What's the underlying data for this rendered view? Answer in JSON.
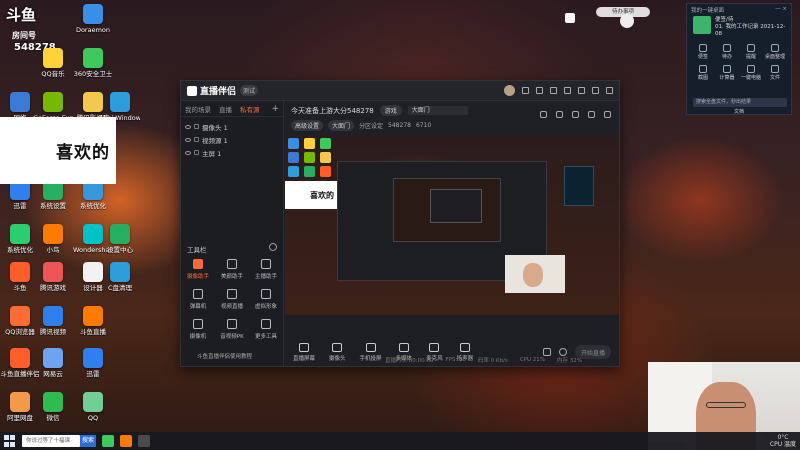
{
  "room_badge": {
    "logo": "斗鱼",
    "title": "房间号",
    "number": "548278"
  },
  "desktop_icons": [
    {
      "label": "Doraemon",
      "color": "#3a8ee6"
    },
    {
      "label": "QQ音乐",
      "color": "#ffd23a"
    },
    {
      "label": "360安全卫士",
      "color": "#3ec95c"
    },
    {
      "label": "网络",
      "color": "#3a7bd5"
    },
    {
      "label": "GeForce Experience",
      "color": "#76b900"
    },
    {
      "label": "腾讯影视库",
      "color": "#f2c94c"
    },
    {
      "label": "Mini Window",
      "color": "#2d9cdb"
    },
    {
      "label": "迅雷",
      "color": "#2f80ed"
    },
    {
      "label": "系统设置",
      "color": "#27ae60"
    },
    {
      "label": "系统优化",
      "color": "#3498db"
    },
    {
      "label": "系统优化",
      "color": "#2ecc71"
    },
    {
      "label": "小鸟",
      "color": "#ff7b00"
    },
    {
      "label": "Wondershare Filmora",
      "color": "#00c2c7"
    },
    {
      "label": "设置中心",
      "color": "#27ae60"
    },
    {
      "label": "斗鱼",
      "color": "#ff5d2a"
    },
    {
      "label": "腾讯游戏",
      "color": "#eb5757"
    },
    {
      "label": "设计器",
      "color": "#f2f2f2"
    },
    {
      "label": "C盘清理",
      "color": "#2d9cdb"
    },
    {
      "label": "QQ浏览器",
      "color": "#ff6b35"
    },
    {
      "label": "腾讯视频",
      "color": "#2f80ed"
    },
    {
      "label": "斗鱼直播",
      "color": "#ff7a00"
    },
    {
      "label": "斗鱼直播伴侣",
      "color": "#ff5d2a"
    },
    {
      "label": "网易云",
      "color": "#6fa3ef"
    },
    {
      "label": "迅雷",
      "color": "#2f80ed"
    },
    {
      "label": "阿里网盘",
      "color": "#f2994a"
    },
    {
      "label": "微信",
      "color": "#2fbb4f"
    },
    {
      "label": "QQ",
      "color": "#6fcf97"
    }
  ],
  "sticker_text": "喜欢的",
  "app": {
    "title": "直播伴侣",
    "beta": "测试",
    "tabs": [
      "我的场景",
      "直播",
      "私有源"
    ],
    "active_tab": "私有源",
    "scenes": [
      "摄像头 1",
      "视频源 1",
      "主屏 1"
    ],
    "tools_title": "工具栏",
    "tools": [
      {
        "label": "摄像助手",
        "hot": true
      },
      {
        "label": "美颜助手",
        "hot": false
      },
      {
        "label": "主播助手",
        "hot": false
      },
      {
        "label": "弹幕机",
        "hot": false
      },
      {
        "label": "视频直播",
        "hot": false
      },
      {
        "label": "虚拟形象",
        "hot": false
      },
      {
        "label": "摄像机",
        "hot": false
      },
      {
        "label": "音视频PK",
        "hot": false
      },
      {
        "label": "更多工具",
        "hot": false
      }
    ],
    "tools_footer": "斗鱼直播伴侣使用教程",
    "stream_title": "今天准备上游大分548278",
    "category_pill": "游戏",
    "category_input": "大面门",
    "row2": [
      "高级设置",
      "大面门",
      "分区设定"
    ],
    "room_id": "548278",
    "viewers": "6710",
    "controls": [
      "直播屏幕",
      "摄像头",
      "手机投屏",
      "多媒体",
      "麦克风",
      "扬声器"
    ],
    "start_label": "开始直播",
    "status": [
      "直播时长 00:00:00",
      "FPS: 30",
      "码率 0 Kb/s",
      "CPU 21%",
      "内存 32%"
    ]
  },
  "widget": {
    "header_left": "我的一键桌面",
    "header_right": "— ×",
    "title": "便签/待",
    "sub": "01. 我的工作记录 2021-12-08",
    "grid": [
      "便签",
      "待办",
      "提醒",
      "桌面整理",
      "截图",
      "计算器",
      "一键电脑",
      "文件"
    ],
    "search": "搜索全盘文件，秒出结果",
    "footer": "文档"
  },
  "top_pill": "待办事项",
  "taskbar": {
    "search_placeholder": "你说过等了十福课",
    "search_btn": "搜索",
    "temp": "0°C",
    "cpu": "CPU 温度"
  }
}
